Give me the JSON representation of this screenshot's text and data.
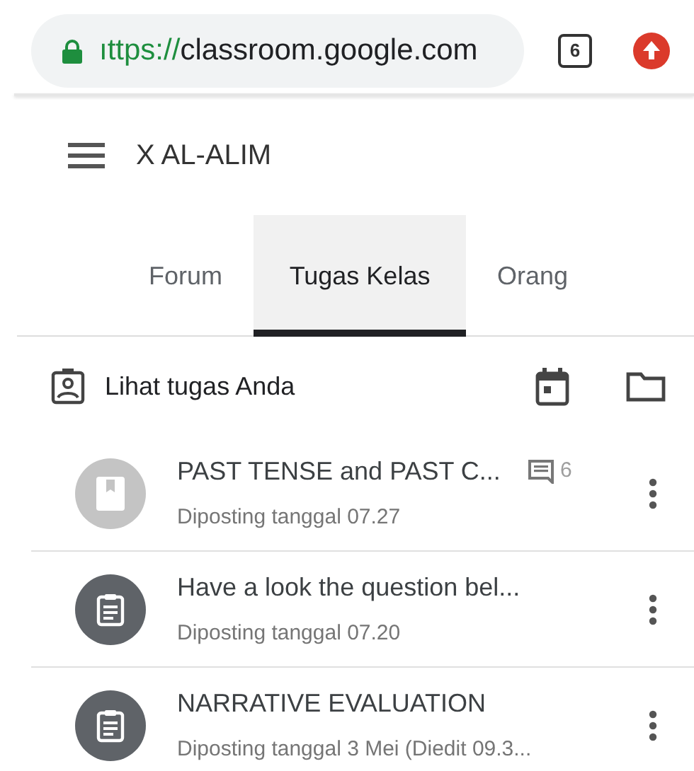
{
  "browser": {
    "url_scheme": "ıttps://",
    "url_host": "classroom.google.com",
    "tab_count": "6"
  },
  "header": {
    "title": "X AL-ALIM"
  },
  "tabs": [
    {
      "label": "Forum",
      "selected": false
    },
    {
      "label": "Tugas Kelas",
      "selected": true
    },
    {
      "label": "Orang",
      "selected": false
    }
  ],
  "toolbar": {
    "label": "Lihat tugas Anda"
  },
  "items": [
    {
      "kind": "material",
      "title": "PAST TENSE and PAST C...",
      "subtitle": "Diposting tanggal 07.27",
      "comments": "6"
    },
    {
      "kind": "assignment",
      "title": "Have a look the question bel...",
      "subtitle": "Diposting tanggal 07.20"
    },
    {
      "kind": "assignment",
      "title": "NARRATIVE EVALUATION",
      "subtitle": "Diposting tanggal 3 Mei (Diedit 09.3..."
    }
  ]
}
